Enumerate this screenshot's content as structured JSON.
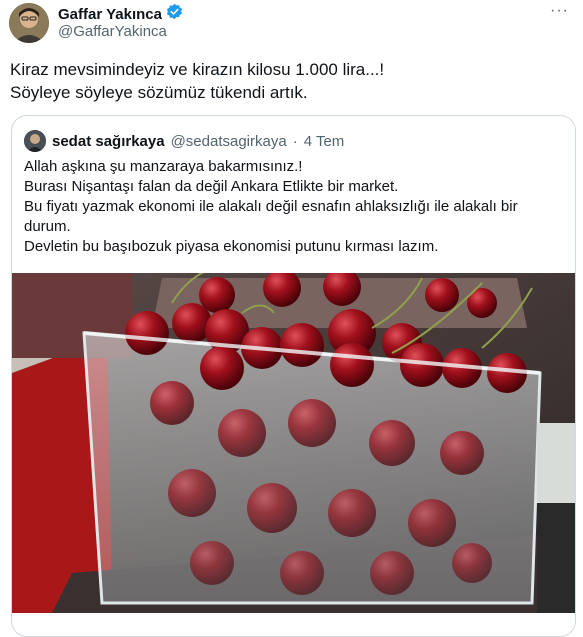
{
  "author": {
    "name": "Gaffar Yakınca",
    "handle": "@GaffarYakinca",
    "verified_color": "#1d9bf0"
  },
  "tweet": {
    "lines": [
      "Kiraz mevsimindeyiz ve kirazın kilosu 1.000 lira...!",
      "Söyleye söyleye sözümüz tükendi artık."
    ]
  },
  "quote": {
    "name": "sedat sağırkaya",
    "handle": "@sedatsagirkaya",
    "separator": "·",
    "time": "4 Tem",
    "lines": [
      "Allah aşkına şu manzaraya bakarmısınız.!",
      "Burası Nişantaşı falan da değil Ankara Etlikte bir market.",
      "Bu fiyatı yazmak ekonomi ile alakalı değil esnafın ahlaksızlığı ile alakalı bir",
      "durum.",
      "Devletin bu başıbozuk piyasa ekonomisi putunu kırması lazım."
    ]
  },
  "icons": {
    "more": "more-options-icon",
    "verified": "verified-badge-icon"
  }
}
